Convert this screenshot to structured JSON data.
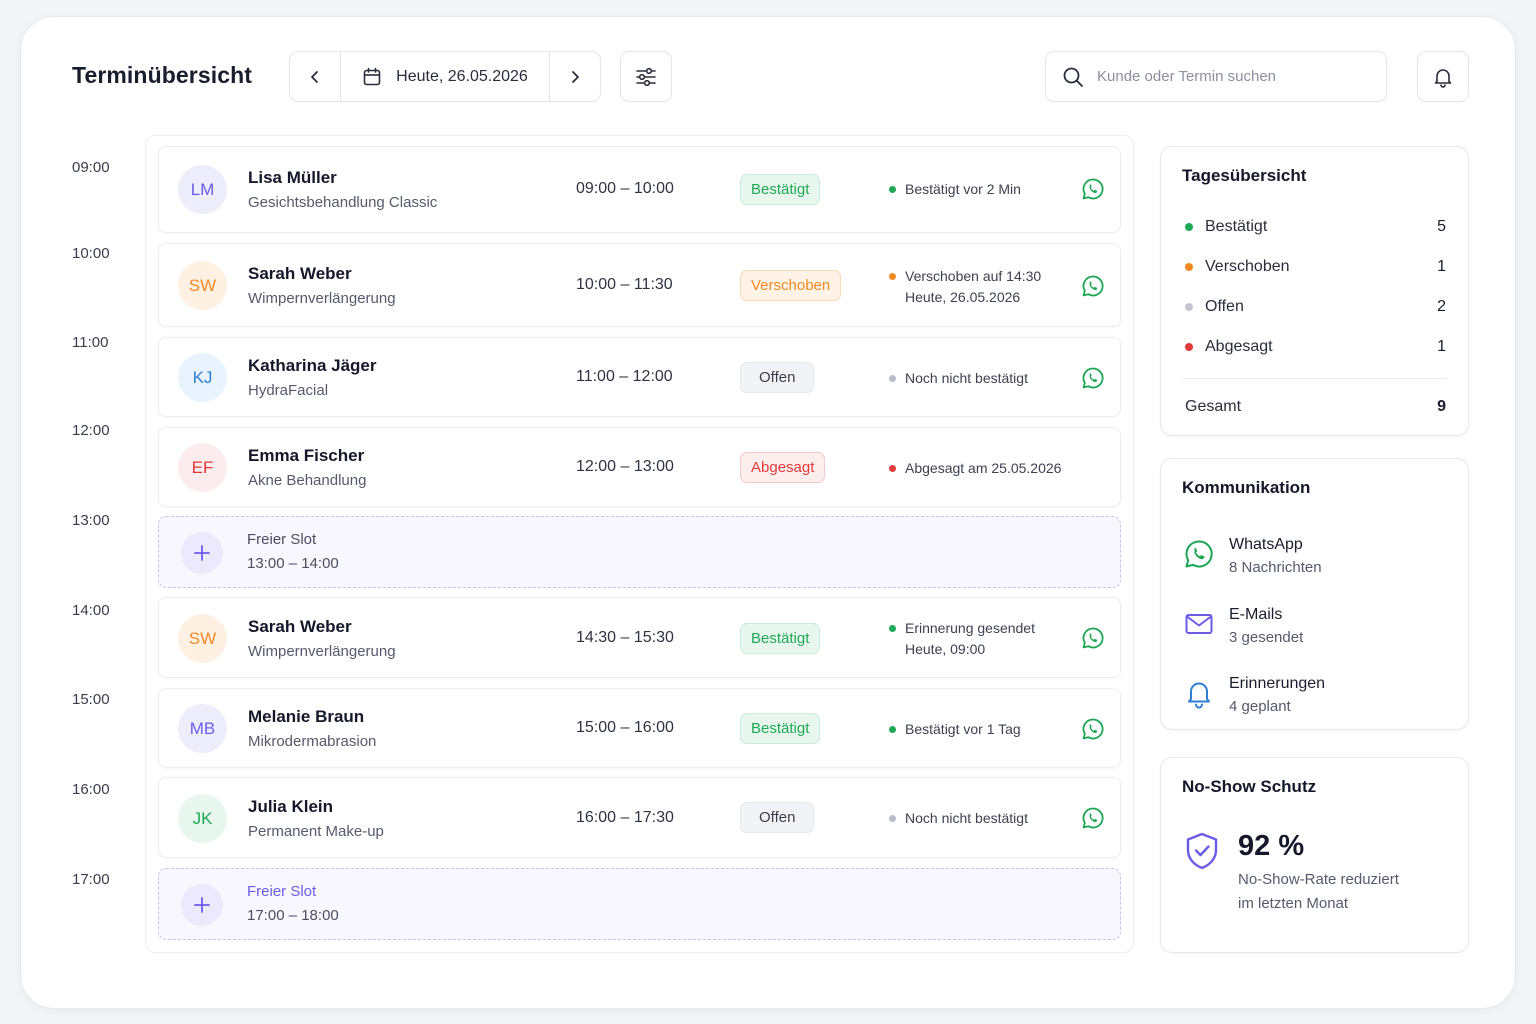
{
  "header": {
    "title": "Terminübersicht",
    "date": "Heute, 26.05.2026",
    "search_placeholder": "Kunde oder Termin suchen"
  },
  "timeline": [
    "09:00",
    "10:00",
    "11:00",
    "12:00",
    "13:00",
    "14:00",
    "15:00",
    "16:00",
    "17:00"
  ],
  "colors": {
    "accent": "#6b5ce7",
    "confirmed": "#1fa855",
    "postponed": "#f08a24",
    "open": "#b8bcc8",
    "cancelled": "#e03a3a",
    "whatsapp": "#1ba552"
  },
  "appointments": [
    {
      "initials": "LM",
      "name": "Lisa Müller",
      "service": "Gesichtsbehandlung Classic",
      "time": "09:00 – 10:00",
      "badge": "Bestätigt",
      "status1": "Bestätigt vor 2 Min",
      "status2": "",
      "whatsapp_icon": "whatsapp-icon"
    },
    {
      "initials": "SW",
      "name": "Sarah Weber",
      "service": "Wimpernverlängerung",
      "time": "10:00 – 11:30",
      "badge": "Verschoben",
      "status1": "Verschoben auf 14:30",
      "status2": "Heute, 26.05.2026",
      "whatsapp_icon": "whatsapp-icon"
    },
    {
      "initials": "KJ",
      "name": "Katharina Jäger",
      "service": "HydraFacial",
      "time": "11:00 – 12:00",
      "badge": "Offen",
      "status1": "Noch nicht bestätigt",
      "status2": "",
      "whatsapp_icon": "whatsapp-icon"
    },
    {
      "initials": "EF",
      "name": "Emma Fischer",
      "service": "Akne Behandlung",
      "time": "12:00 – 13:00",
      "badge": "Abgesagt",
      "status1": "Abgesagt am 25.05.2026",
      "status2": ""
    },
    {
      "initials": "SW",
      "name": "Sarah Weber",
      "service": "Wimpernverlängerung",
      "time": "14:30 – 15:30",
      "badge": "Bestätigt",
      "status1": "Erinnerung gesendet",
      "status2": "Heute, 09:00",
      "whatsapp_icon": "whatsapp-icon"
    },
    {
      "initials": "MB",
      "name": "Melanie Braun",
      "service": "Mikrodermabrasion",
      "time": "15:00 – 16:00",
      "badge": "Bestätigt",
      "status1": "Bestätigt vor 1 Tag",
      "status2": "",
      "whatsapp_icon": "whatsapp-icon"
    },
    {
      "initials": "JK",
      "name": "Julia Klein",
      "service": "Permanent Make-up",
      "time": "16:00 – 17:30",
      "badge": "Offen",
      "status1": "Noch nicht bestätigt",
      "status2": "",
      "whatsapp_icon": "whatsapp-icon"
    }
  ],
  "free_slots": [
    {
      "label": "Freier Slot",
      "time": "13:00 – 14:00"
    },
    {
      "label": "Freier Slot",
      "time": "17:00 – 18:00"
    }
  ],
  "summary": {
    "title": "Tagesübersicht",
    "rows": [
      {
        "label": "Bestätigt",
        "value": "5"
      },
      {
        "label": "Verschoben",
        "value": "1"
      },
      {
        "label": "Offen",
        "value": "2"
      },
      {
        "label": "Abgesagt",
        "value": "1"
      }
    ],
    "total_label": "Gesamt",
    "total_value": "9"
  },
  "communication": {
    "title": "Kommunikation",
    "items": [
      {
        "title": "WhatsApp",
        "detail": "8 Nachrichten",
        "icon": "whatsapp-icon"
      },
      {
        "title": "E-Mails",
        "detail": "3 gesendet",
        "icon": "mail-icon"
      },
      {
        "title": "Erinnerungen",
        "detail": "4 geplant",
        "icon": "bell-icon"
      }
    ]
  },
  "noshow": {
    "title": "No-Show Schutz",
    "value": "92 %",
    "line1": "No-Show-Rate reduziert",
    "line2": "im letzten Monat",
    "icon": "shield-check-icon"
  }
}
